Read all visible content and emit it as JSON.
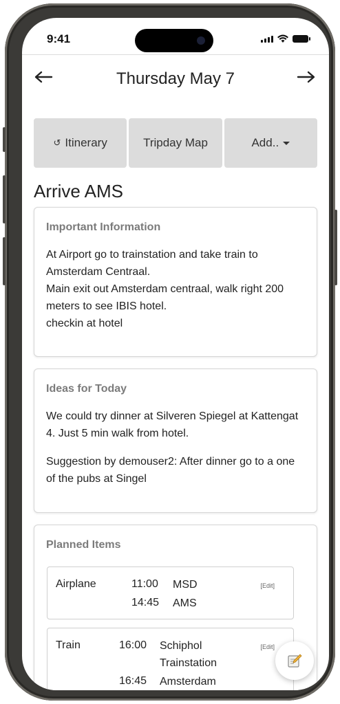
{
  "status_bar": {
    "time": "9:41"
  },
  "header": {
    "title": "Thursday May 7",
    "prev_icon": "arrow-left-icon",
    "next_icon": "arrow-right-icon"
  },
  "tabs": [
    {
      "label": "Itinerary",
      "icon": "↺"
    },
    {
      "label": "Tripday Map"
    },
    {
      "label": "Add.."
    }
  ],
  "page_title": "Arrive AMS",
  "important": {
    "heading": "Important Information",
    "lines": [
      "At Airport go to trainstation and take train to Amsterdam Centraal.",
      "Main exit out Amsterdam centraal, walk right 200 meters to see IBIS hotel.",
      "checkin at hotel"
    ]
  },
  "ideas": {
    "heading": "Ideas for Today",
    "paragraphs": [
      "We could try dinner at Silveren Spiegel at Kattengat 4. Just 5 min walk from hotel.",
      "Suggestion by demouser2: After dinner go to a one of the pubs at Singel"
    ]
  },
  "planned": {
    "heading": "Planned Items",
    "items": [
      {
        "type": "Airplane",
        "edit_label": "[Edit]",
        "stops": [
          {
            "time": "11:00",
            "place": "MSD"
          },
          {
            "time": "14:45",
            "place": "AMS"
          }
        ]
      },
      {
        "type": "Train",
        "edit_label": "[Edit]",
        "stops": [
          {
            "time": "16:00",
            "place": "Schiphol Trainstation"
          },
          {
            "time": "16:45",
            "place": "Amsterdam Centraal"
          }
        ]
      }
    ]
  },
  "fab": {
    "icon": "note-edit-icon"
  }
}
